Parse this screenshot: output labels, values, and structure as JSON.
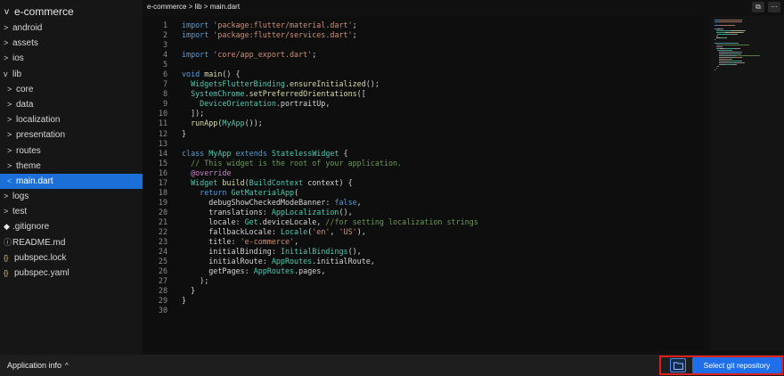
{
  "sidebar": {
    "project": "e-commerce",
    "items": [
      {
        "label": "android",
        "glyph": ">",
        "level": 0
      },
      {
        "label": "assets",
        "glyph": ">",
        "level": 0
      },
      {
        "label": "ios",
        "glyph": ">",
        "level": 0
      },
      {
        "label": "lib",
        "glyph": "v",
        "level": 0
      },
      {
        "label": "core",
        "glyph": ">",
        "level": 1
      },
      {
        "label": "data",
        "glyph": ">",
        "level": 1
      },
      {
        "label": "localization",
        "glyph": ">",
        "level": 1
      },
      {
        "label": "presentation",
        "glyph": ">",
        "level": 1
      },
      {
        "label": "routes",
        "glyph": ">",
        "level": 1
      },
      {
        "label": "theme",
        "glyph": ">",
        "level": 1
      },
      {
        "label": "main.dart",
        "glyph": "<",
        "level": 1,
        "selected": true
      },
      {
        "label": "logs",
        "glyph": ">",
        "level": 0
      },
      {
        "label": "test",
        "glyph": ">",
        "level": 0
      },
      {
        "label": ".gitignore",
        "glyph": "◆",
        "level": 0
      },
      {
        "label": "README.md",
        "glyph": "ⓘ",
        "level": 0
      },
      {
        "label": "pubspec.lock",
        "glyph": "{}",
        "level": 0
      },
      {
        "label": "pubspec.yaml",
        "glyph": "{}",
        "level": 0
      }
    ]
  },
  "breadcrumb": "e-commerce > lib > main.dart",
  "editor": {
    "lines": [
      [
        {
          "t": "import ",
          "c": "kw"
        },
        {
          "t": "'package:flutter/material.dart'",
          "c": "str"
        },
        {
          "t": ";",
          "c": ""
        }
      ],
      [
        {
          "t": "import ",
          "c": "kw"
        },
        {
          "t": "'package:flutter/services.dart'",
          "c": "str"
        },
        {
          "t": ";",
          "c": ""
        }
      ],
      [],
      [
        {
          "t": "import ",
          "c": "kw"
        },
        {
          "t": "'core/app_export.dart'",
          "c": "str"
        },
        {
          "t": ";",
          "c": ""
        }
      ],
      [],
      [
        {
          "t": "void ",
          "c": "kw"
        },
        {
          "t": "main",
          "c": "fn"
        },
        {
          "t": "() {",
          "c": ""
        }
      ],
      [
        {
          "t": "  WidgetsFlutterBinding",
          "c": "cls"
        },
        {
          "t": ".",
          "c": ""
        },
        {
          "t": "ensureInitialized",
          "c": "fn"
        },
        {
          "t": "();",
          "c": ""
        }
      ],
      [
        {
          "t": "  SystemChrome",
          "c": "cls"
        },
        {
          "t": ".",
          "c": ""
        },
        {
          "t": "setPreferredOrientations",
          "c": "fn"
        },
        {
          "t": "([",
          "c": ""
        }
      ],
      [
        {
          "t": "    DeviceOrientation",
          "c": "cls"
        },
        {
          "t": ".portraitUp,",
          "c": ""
        }
      ],
      [
        {
          "t": "  ]);",
          "c": ""
        }
      ],
      [
        {
          "t": "  ",
          "c": ""
        },
        {
          "t": "runApp",
          "c": "fn"
        },
        {
          "t": "(",
          "c": ""
        },
        {
          "t": "MyApp",
          "c": "cls"
        },
        {
          "t": "());",
          "c": ""
        }
      ],
      [
        {
          "t": "}",
          "c": ""
        }
      ],
      [],
      [
        {
          "t": "class ",
          "c": "kw"
        },
        {
          "t": "MyApp ",
          "c": "cls"
        },
        {
          "t": "extends ",
          "c": "kw"
        },
        {
          "t": "StatelessWidget",
          "c": "cls"
        },
        {
          "t": " {",
          "c": ""
        }
      ],
      [
        {
          "t": "  // This widget is the root of your application.",
          "c": "cmt"
        }
      ],
      [
        {
          "t": "  @override",
          "c": "ann"
        }
      ],
      [
        {
          "t": "  Widget ",
          "c": "cls"
        },
        {
          "t": "build",
          "c": "fn"
        },
        {
          "t": "(",
          "c": ""
        },
        {
          "t": "BuildContext ",
          "c": "cls"
        },
        {
          "t": "context) {",
          "c": ""
        }
      ],
      [
        {
          "t": "    return ",
          "c": "kw"
        },
        {
          "t": "GetMaterialApp",
          "c": "cls"
        },
        {
          "t": "(",
          "c": ""
        }
      ],
      [
        {
          "t": "      debugShowCheckedModeBanner: ",
          "c": ""
        },
        {
          "t": "false",
          "c": "kw"
        },
        {
          "t": ",",
          "c": ""
        }
      ],
      [
        {
          "t": "      translations: ",
          "c": ""
        },
        {
          "t": "AppLocalization",
          "c": "cls"
        },
        {
          "t": "(),",
          "c": ""
        }
      ],
      [
        {
          "t": "      locale: ",
          "c": ""
        },
        {
          "t": "Get",
          "c": "cls"
        },
        {
          "t": ".deviceLocale, ",
          "c": ""
        },
        {
          "t": "//for setting localization strings",
          "c": "cmt"
        }
      ],
      [
        {
          "t": "      fallbackLocale: ",
          "c": ""
        },
        {
          "t": "Locale",
          "c": "cls"
        },
        {
          "t": "(",
          "c": ""
        },
        {
          "t": "'en'",
          "c": "str"
        },
        {
          "t": ", ",
          "c": ""
        },
        {
          "t": "'US'",
          "c": "str"
        },
        {
          "t": "),",
          "c": ""
        }
      ],
      [
        {
          "t": "      title: ",
          "c": ""
        },
        {
          "t": "'e-commerce'",
          "c": "str"
        },
        {
          "t": ",",
          "c": ""
        }
      ],
      [
        {
          "t": "      initialBinding: ",
          "c": ""
        },
        {
          "t": "InitialBindings",
          "c": "cls"
        },
        {
          "t": "(),",
          "c": ""
        }
      ],
      [
        {
          "t": "      initialRoute: ",
          "c": ""
        },
        {
          "t": "AppRoutes",
          "c": "cls"
        },
        {
          "t": ".initialRoute,",
          "c": ""
        }
      ],
      [
        {
          "t": "      getPages: ",
          "c": ""
        },
        {
          "t": "AppRoutes",
          "c": "cls"
        },
        {
          "t": ".pages,",
          "c": ""
        }
      ],
      [
        {
          "t": "    );",
          "c": ""
        }
      ],
      [
        {
          "t": "  }",
          "c": ""
        }
      ],
      [
        {
          "t": "}",
          "c": ""
        }
      ],
      []
    ]
  },
  "top_icons": [
    {
      "name": "split-editor-icon",
      "glyph": "⧉"
    },
    {
      "name": "more-icon",
      "glyph": "⋯"
    }
  ],
  "bottom": {
    "app_info": "Application info",
    "folder_icon": "folder-icon",
    "git_button": "Select git repository"
  },
  "colors": {
    "selected": "#1b6fd6",
    "button": "#1f6feb",
    "highlight_border": "#e0201f"
  }
}
